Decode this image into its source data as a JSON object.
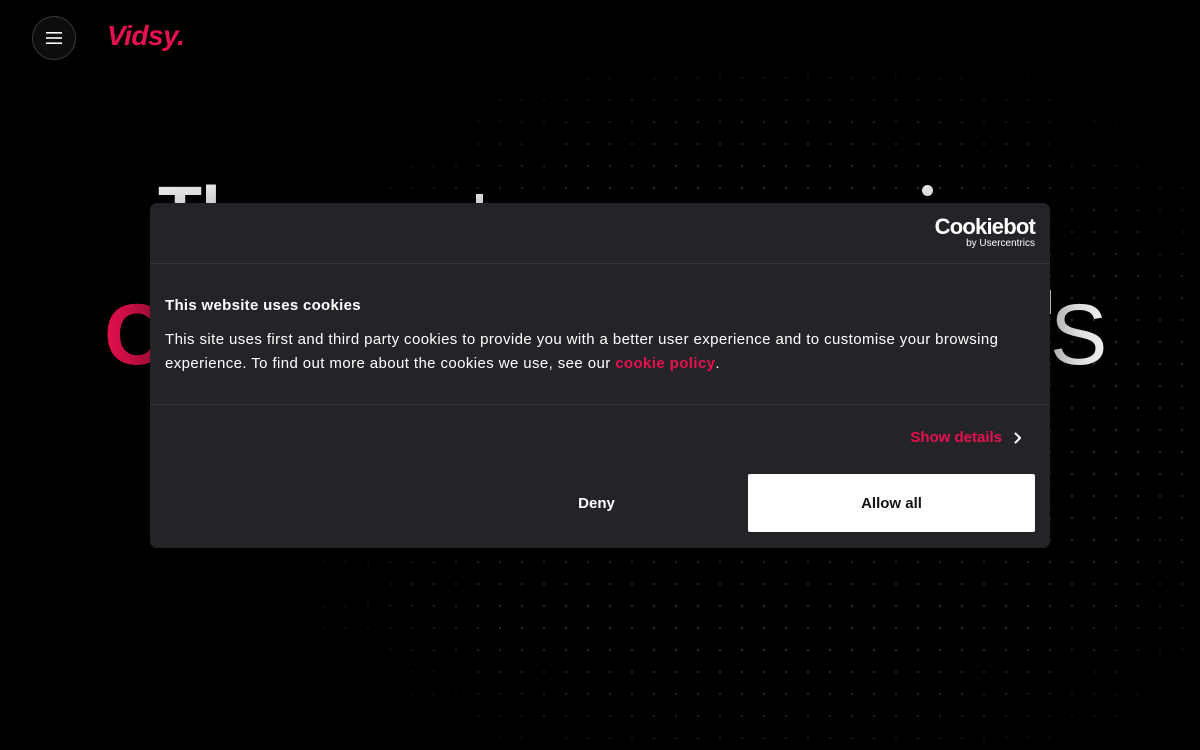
{
  "header": {
    "menu_icon": "hamburger-menu-icon",
    "logo_text": "Vidsy."
  },
  "hero": {
    "line1_visible": "Tl",
    "line2_left_visible": "C",
    "line2_right_visible": "S"
  },
  "cookie_dialog": {
    "brand_name": "Cookiebot",
    "brand_sub": "by Usercentrics",
    "title": "This website uses cookies",
    "text_before_link": "This site uses first and third party cookies to provide you with a better user experience and to customise your browsing experience. To find out more about the cookies we use, see our ",
    "link_text": "cookie policy",
    "text_after_link": ".",
    "show_details_label": "Show details",
    "show_details_icon": "chevron-right-icon",
    "deny_label": "Deny",
    "allow_label": "Allow all"
  },
  "colors": {
    "accent": "#e8114f",
    "background": "#000000",
    "dialog": "#232328"
  }
}
